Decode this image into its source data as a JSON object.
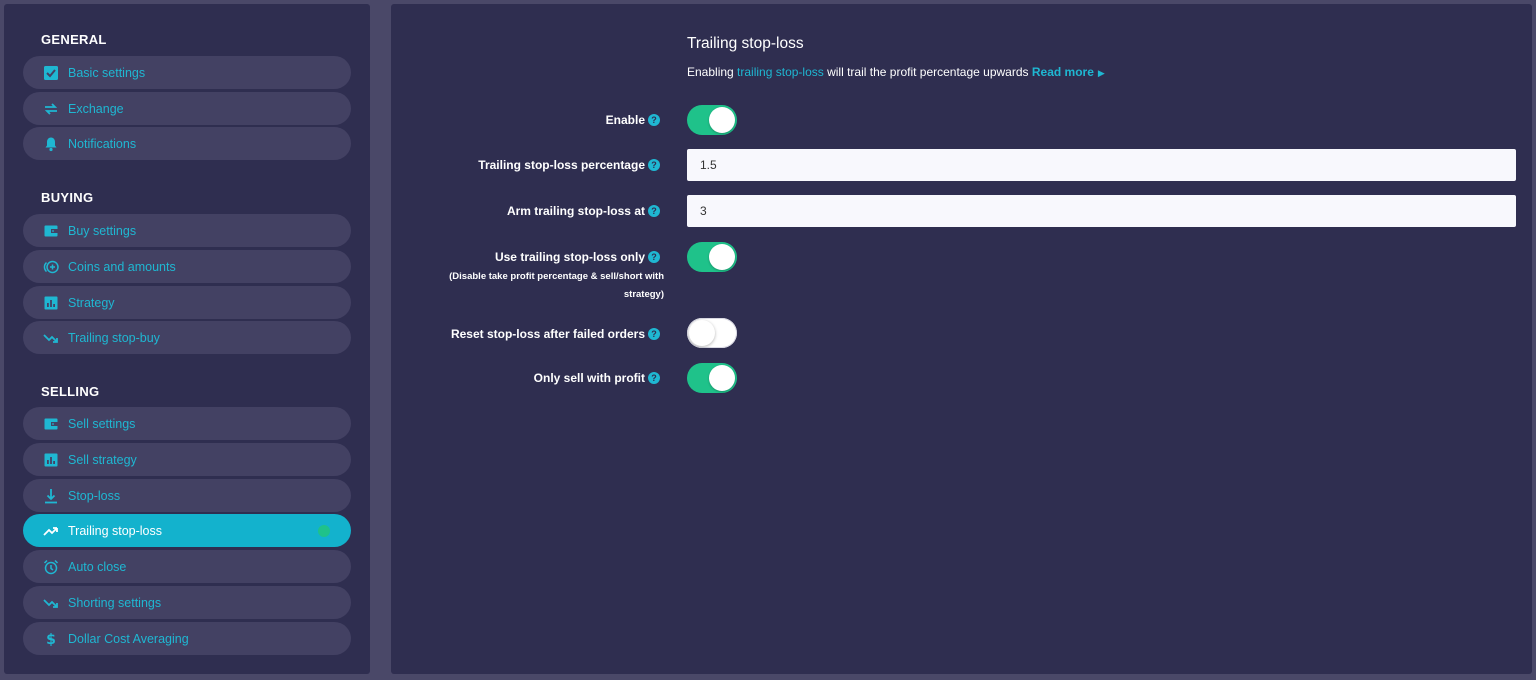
{
  "sidebar": {
    "sections": [
      {
        "title": "GENERAL",
        "items": [
          {
            "label": "Basic settings",
            "icon": "checkbox-icon"
          },
          {
            "label": "Exchange",
            "icon": "exchange-arrows-icon"
          },
          {
            "label": "Notifications",
            "icon": "bell-icon"
          }
        ]
      },
      {
        "title": "BUYING",
        "items": [
          {
            "label": "Buy settings",
            "icon": "wallet-icon"
          },
          {
            "label": "Coins and amounts",
            "icon": "coins-plus-icon"
          },
          {
            "label": "Strategy",
            "icon": "bar-chart-icon"
          },
          {
            "label": "Trailing stop-buy",
            "icon": "trend-down-icon"
          }
        ]
      },
      {
        "title": "SELLING",
        "items": [
          {
            "label": "Sell settings",
            "icon": "wallet-icon"
          },
          {
            "label": "Sell strategy",
            "icon": "bar-chart-icon"
          },
          {
            "label": "Stop-loss",
            "icon": "download-arrow-icon"
          },
          {
            "label": "Trailing stop-loss",
            "icon": "trend-up-icon",
            "active": true
          },
          {
            "label": "Auto close",
            "icon": "alarm-clock-icon"
          },
          {
            "label": "Shorting settings",
            "icon": "trend-down-icon"
          },
          {
            "label": "Dollar Cost Averaging",
            "icon": "dollar-icon"
          }
        ]
      }
    ]
  },
  "main": {
    "title": "Trailing stop-loss",
    "description": {
      "prefix": "Enabling ",
      "link": "trailing stop-loss",
      "suffix": " will trail the profit percentage upwards ",
      "read_more": "Read more"
    },
    "help_glyph": "?",
    "fields": {
      "enable": {
        "label": "Enable",
        "value": true
      },
      "percentage": {
        "label": "Trailing stop-loss percentage",
        "value": "1.5"
      },
      "arm_at": {
        "label": "Arm trailing stop-loss at",
        "value": "3"
      },
      "only": {
        "label": "Use trailing stop-loss only",
        "sublabel": "(Disable take profit percentage & sell/short with strategy)",
        "value": true
      },
      "reset": {
        "label": "Reset stop-loss after failed orders",
        "value": false
      },
      "profit_only": {
        "label": "Only sell with profit",
        "value": true
      }
    }
  },
  "colors": {
    "background": "#4a4868",
    "panel": "#2f2e50",
    "nav_item": "#434163",
    "accent": "#13b2cd",
    "toggle_on": "#1fc28a"
  }
}
